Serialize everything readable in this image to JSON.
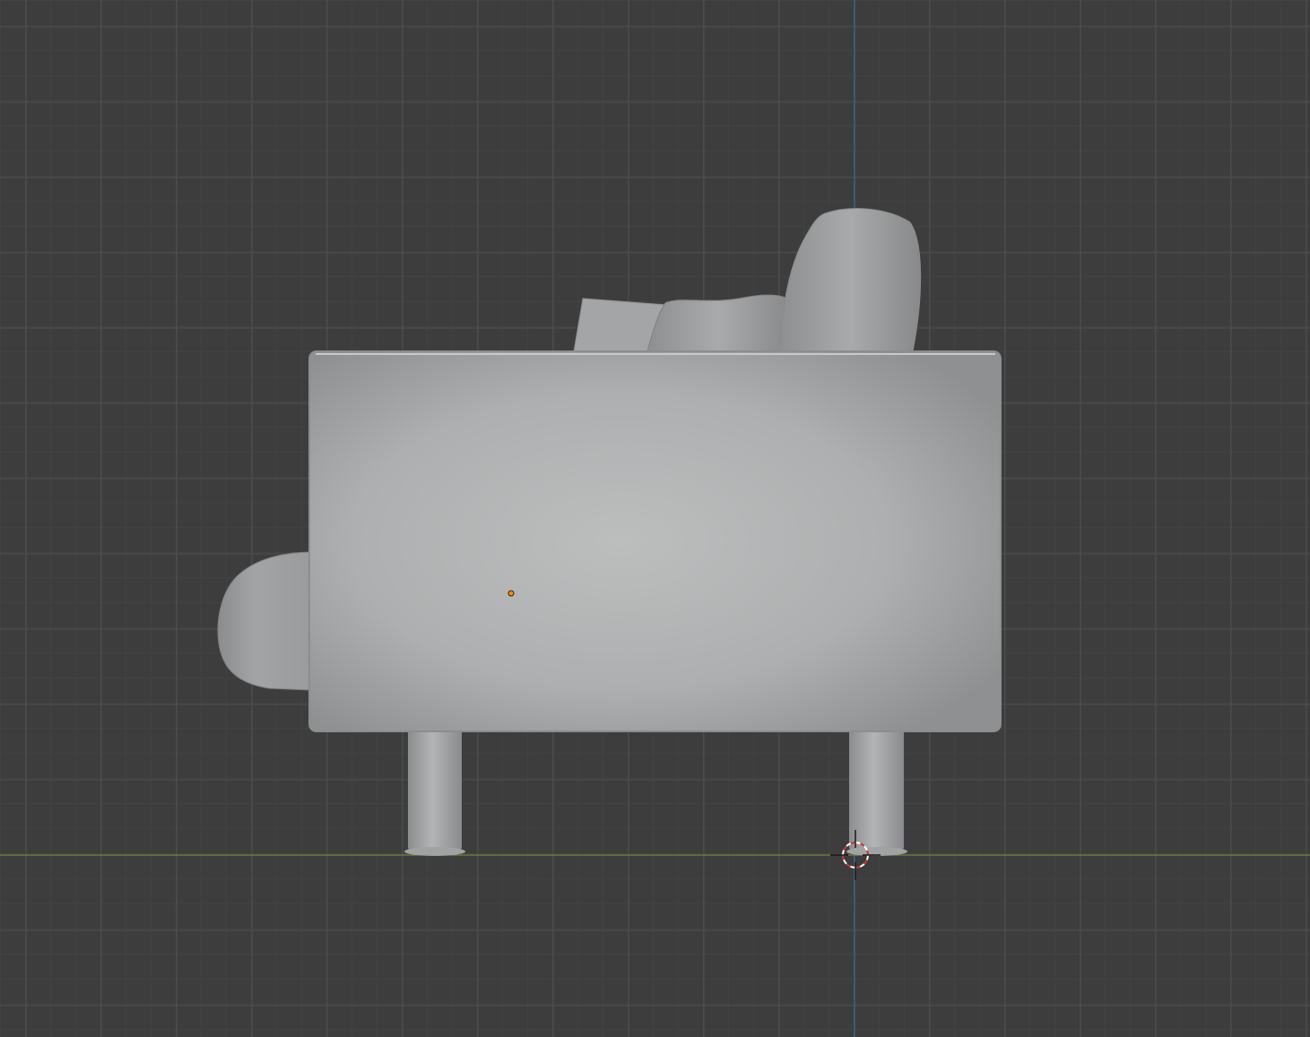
{
  "viewport": {
    "background_color": "#3d3d3d",
    "grid_minor_color": "#474747",
    "grid_major_color": "#4f4f4f",
    "x_axis_color": "#7a9a3a",
    "z_axis_color": "#3a6fb0",
    "view": "side-orthographic"
  },
  "scene": {
    "object": "sofa",
    "object_color": "#a9aaab",
    "origin_color": "#ff8a00",
    "cursor_colors": [
      "#ffffff",
      "#d23232"
    ],
    "icons": {
      "origin": "object-origin-icon",
      "cursor": "3d-cursor-icon"
    }
  }
}
